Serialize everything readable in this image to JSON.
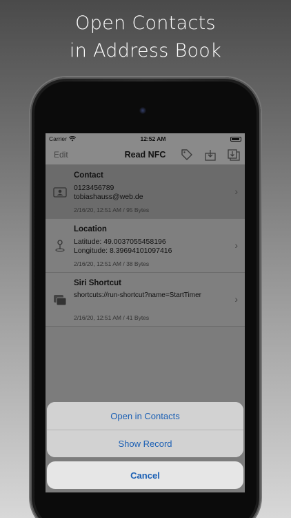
{
  "headline": {
    "line1": "Open Contacts",
    "line2": "in Address Book"
  },
  "status": {
    "carrier": "Carrier",
    "time": "12:52 AM"
  },
  "nav": {
    "edit_label": "Edit",
    "title": "Read NFC",
    "icons": [
      "tag-icon",
      "download-icon",
      "export-icon"
    ]
  },
  "records": [
    {
      "title": "Contact",
      "lines": [
        "0123456789",
        "tobiashauss@web.de"
      ],
      "meta": "2/16/20, 12:51 AM / 95 Bytes",
      "icon": "contact-card-icon",
      "selected": true
    },
    {
      "title": "Location",
      "lines": [
        "Latitude: 49.0037055458196",
        "Longitude: 8.39694101097416"
      ],
      "meta": "2/16/20, 12:51 AM / 38 Bytes",
      "icon": "location-pin-icon",
      "selected": false
    },
    {
      "title": "Siri Shortcut",
      "lines": [
        "shortcuts://run-shortcut?name=StartTimer"
      ],
      "meta": "2/16/20, 12:51 AM / 41 Bytes",
      "icon": "shortcut-stack-icon",
      "selected": false
    }
  ],
  "action_sheet": {
    "open_contacts": "Open in Contacts",
    "show_record": "Show Record",
    "cancel": "Cancel"
  },
  "colors": {
    "accent": "#1a5fb4"
  }
}
